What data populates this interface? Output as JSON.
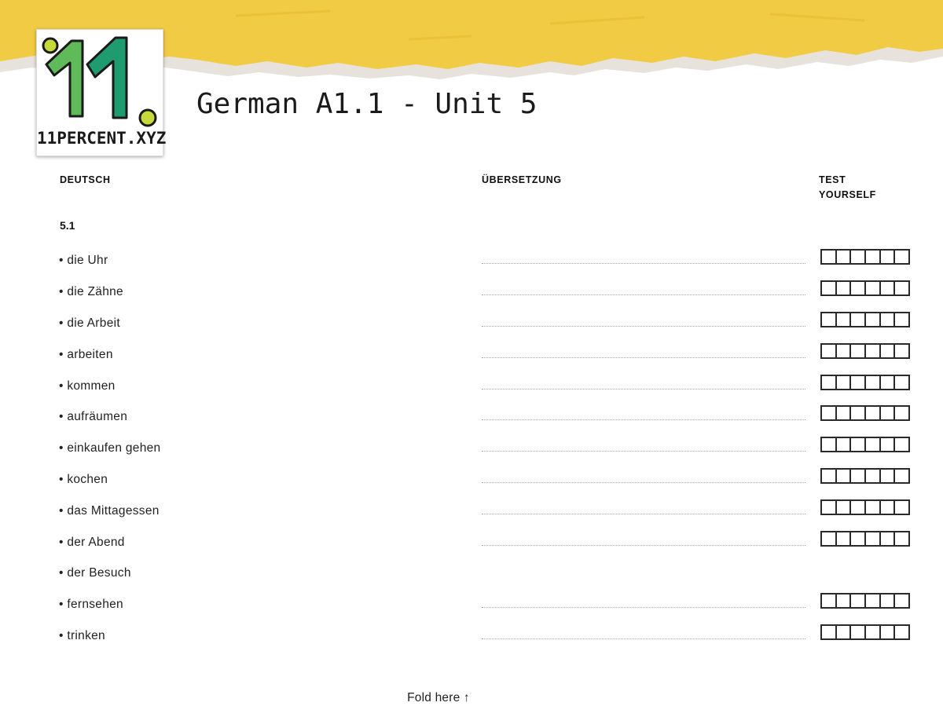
{
  "header": {
    "logo_text": "11PERCENT.XYZ",
    "logo_digits": "11.",
    "title": "German A1.1 - Unit 5"
  },
  "columns": {
    "deutsch": "DEUTSCH",
    "uebersetzung": "ÜBERSETZUNG",
    "test_line1": "TEST",
    "test_line2": "YOURSELF"
  },
  "section": "5.1",
  "vocab": [
    {
      "word": "• die Uhr",
      "has_boxes": true
    },
    {
      "word": "• die Zähne",
      "has_boxes": true
    },
    {
      "word": "• die Arbeit",
      "has_boxes": true
    },
    {
      "word": "• arbeiten",
      "has_boxes": true
    },
    {
      "word": "• kommen",
      "has_boxes": true
    },
    {
      "word": "• aufräumen",
      "has_boxes": true
    },
    {
      "word": "• einkaufen gehen",
      "has_boxes": true
    },
    {
      "word": "• kochen",
      "has_boxes": true
    },
    {
      "word": "• das Mittagessen",
      "has_boxes": true
    },
    {
      "word": "• der Abend",
      "has_boxes": true
    },
    {
      "word": "• der Besuch",
      "has_boxes": false
    },
    {
      "word": "• fernsehen",
      "has_boxes": true
    },
    {
      "word": "• trinken",
      "has_boxes": true
    }
  ],
  "footer": {
    "fold": "Fold here ↑"
  },
  "colors": {
    "banner": "#f2cb44",
    "logo_green": "#1e9b6f",
    "logo_lime": "#c7d93a"
  }
}
